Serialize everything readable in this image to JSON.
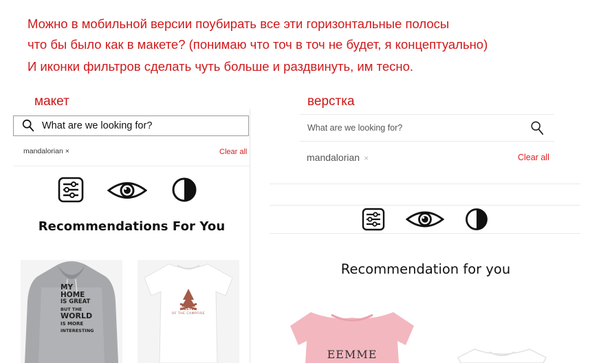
{
  "note": {
    "lines": [
      "Можно в мобильной версии поубирать все эти горизонтальные полосы",
      "что бы было как в макете? (понимаю что точ в точ не будет, я концептуально)",
      "И иконки фильтров сделать чуть больше и раздвинуть, им тесно."
    ]
  },
  "mockup": {
    "label": "макет",
    "search": {
      "placeholder": "What are we looking for?",
      "icon": "search-icon"
    },
    "filter_chip": "mandalorian ×",
    "clear_all": "Clear all",
    "filter_icons": [
      "sliders-icon",
      "eye-icon",
      "contrast-icon"
    ],
    "heading": "Recommendations For You",
    "products": [
      {
        "name": "hoodie-product",
        "print_lines": [
          "MY HOME",
          "IS GREAT",
          "BUT THE",
          "WORLD",
          "IS MORE",
          "INTERESTING"
        ]
      },
      {
        "name": "tshirt-product",
        "print_lines": [
          "MASTER",
          "OF THE CAMPFIRE"
        ]
      }
    ]
  },
  "layout": {
    "label": "верстка",
    "search": {
      "placeholder": "What are we looking for?",
      "icon": "search-icon"
    },
    "filter_chip": "mandalorian",
    "filter_chip_remove": "×",
    "clear_all": "Clear all",
    "filter_icons": [
      "sliders-icon",
      "eye-icon",
      "contrast-icon"
    ],
    "heading": "Recommendation for you",
    "products": [
      {
        "name": "pink-tshirt-product",
        "print_text": "EEMME"
      },
      {
        "name": "white-tshirt-product"
      }
    ]
  },
  "colors": {
    "note_text": "#d0191b",
    "accent_red": "#d11e1e",
    "divider": "#e9e9e9",
    "hoodie_grey": "#a7a8ab",
    "pink_tee": "#f3b7bf",
    "campfire_print": "#a55a4a"
  }
}
